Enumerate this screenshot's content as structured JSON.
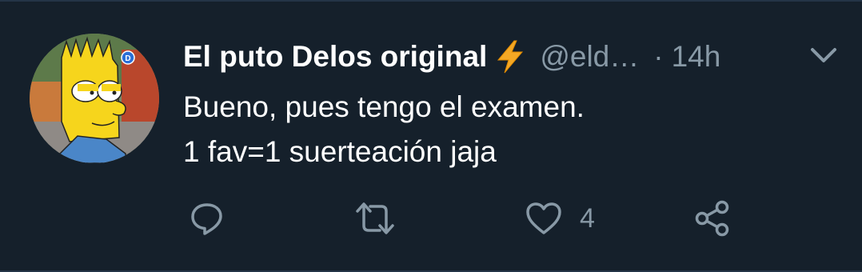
{
  "tweet": {
    "display_name": "El puto Delos original",
    "verified_emoji_icon": "lightning-bolt-icon",
    "handle": "@eld…",
    "separator": "·",
    "time": "14h",
    "text_lines": [
      "Bueno, pues tengo el examen.",
      "1 fav=1 suerteación jaja"
    ],
    "actions": {
      "reply_icon": "reply-icon",
      "retweet_icon": "retweet-icon",
      "like_icon": "heart-icon",
      "like_count": "4",
      "share_icon": "share-icon"
    },
    "menu_icon": "chevron-down-icon"
  },
  "colors": {
    "background": "#15202b",
    "text_primary": "#ffffff",
    "text_secondary": "#8899a6",
    "bolt": "#f4a825",
    "border": "#243447"
  }
}
